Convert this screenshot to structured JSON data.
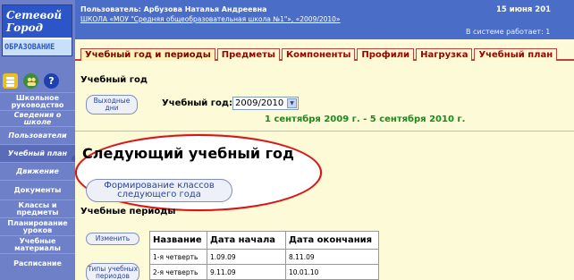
{
  "logo": {
    "line1": "Сетевой",
    "line2": "Город",
    "line3": "ОБРАЗОВАНИЕ"
  },
  "quick_icons": [
    "stack-icon",
    "people-icon",
    "help-icon"
  ],
  "sidebar": {
    "items": [
      {
        "label": "Школьное руководство"
      },
      {
        "label": "Сведения о школе"
      },
      {
        "label": "Пользователи"
      },
      {
        "label": "Учебный план"
      },
      {
        "label": "Движение"
      },
      {
        "label": "Документы"
      },
      {
        "label": "Классы и предметы"
      },
      {
        "label": "Планирование уроков"
      },
      {
        "label": "Учебные материалы"
      },
      {
        "label": "Расписание"
      }
    ]
  },
  "header": {
    "user": "Пользователь: Арбузова Наталья Андреевна",
    "school": "ШКОЛА «МОУ \"Средняя общеобразовательная школа №1\"», «2009/2010»",
    "date": "15 июня 201",
    "status": "В системе работает: 1"
  },
  "tabs": [
    {
      "label": "Учебный год и периоды"
    },
    {
      "label": "Предметы"
    },
    {
      "label": "Компоненты"
    },
    {
      "label": "Профили"
    },
    {
      "label": "Нагрузка"
    },
    {
      "label": "Учебный план"
    }
  ],
  "main": {
    "section_year": "Учебный год",
    "btn_holidays": "Выходные дни",
    "year_label": "Учебный год:",
    "year_value": "2009/2010",
    "year_range": "1 сентября 2009 г. - 5 сентября 2010 г.",
    "next_year_title": "Следующий учебный год",
    "btn_form_classes": "Формирование классов следующего года",
    "section_periods": "Учебные периоды",
    "btn_edit": "Изменить",
    "btn_period_types": "Типы учебных периодов"
  },
  "periods_table": {
    "columns": [
      "Название",
      "Дата начала",
      "Дата окончания"
    ],
    "rows": [
      [
        "1-я четверть",
        "1.09.09",
        "8.11.09"
      ],
      [
        "2-я четверть",
        "9.11.09",
        "10.01.10"
      ]
    ]
  },
  "colors": {
    "sidebar": "#6e80c8",
    "header": "#4a6ec8",
    "content_bg": "#fdfad8",
    "tab_text": "#a00000",
    "highlight": "#d01818",
    "date_range": "#1a8a1a"
  }
}
